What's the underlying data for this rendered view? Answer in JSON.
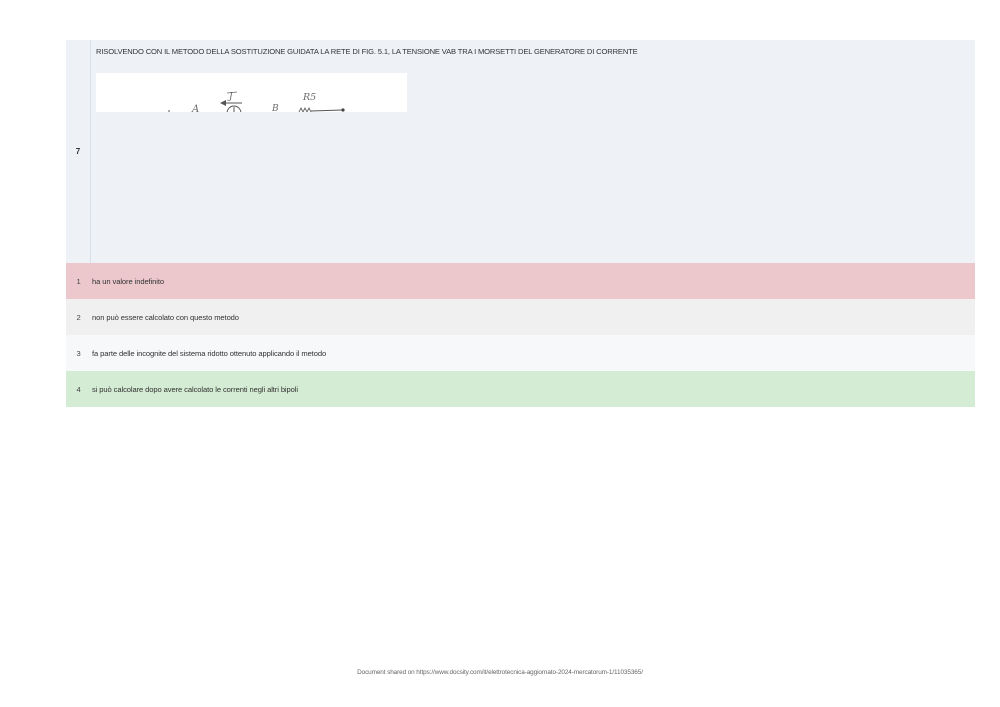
{
  "question": {
    "number": "7",
    "text": "RISOLVENDO CON IL METODO DELLA SOSTITUZIONE GUIDATA LA RETE DI FIG. 5.1, LA TENSIONE VAB TRA I MORSETTI DEL GENERATORE DI CORRENTE",
    "figure_labels": {
      "node_a": "A",
      "current": "J",
      "node_b": "B",
      "resistor": "R5"
    }
  },
  "answers": [
    {
      "number": "1",
      "text": "ha un valore indefinito",
      "color": "#ecc8cd"
    },
    {
      "number": "2",
      "text": "non può essere calcolato con questo metodo",
      "color": "#eff0ef"
    },
    {
      "number": "3",
      "text": "fa parte delle incognite del sistema ridotto ottenuto applicando il metodo",
      "color": "#f7f8fa"
    },
    {
      "number": "4",
      "text": "si può calcolare dopo avere calcolato le correnti negli altri bipoli",
      "color": "#d3ecd3"
    }
  ],
  "footer": {
    "text": "Document shared on https://www.docsity.com/it/elettrotecnica-aggiornato-2024-mercatorum-1/11035365/"
  }
}
